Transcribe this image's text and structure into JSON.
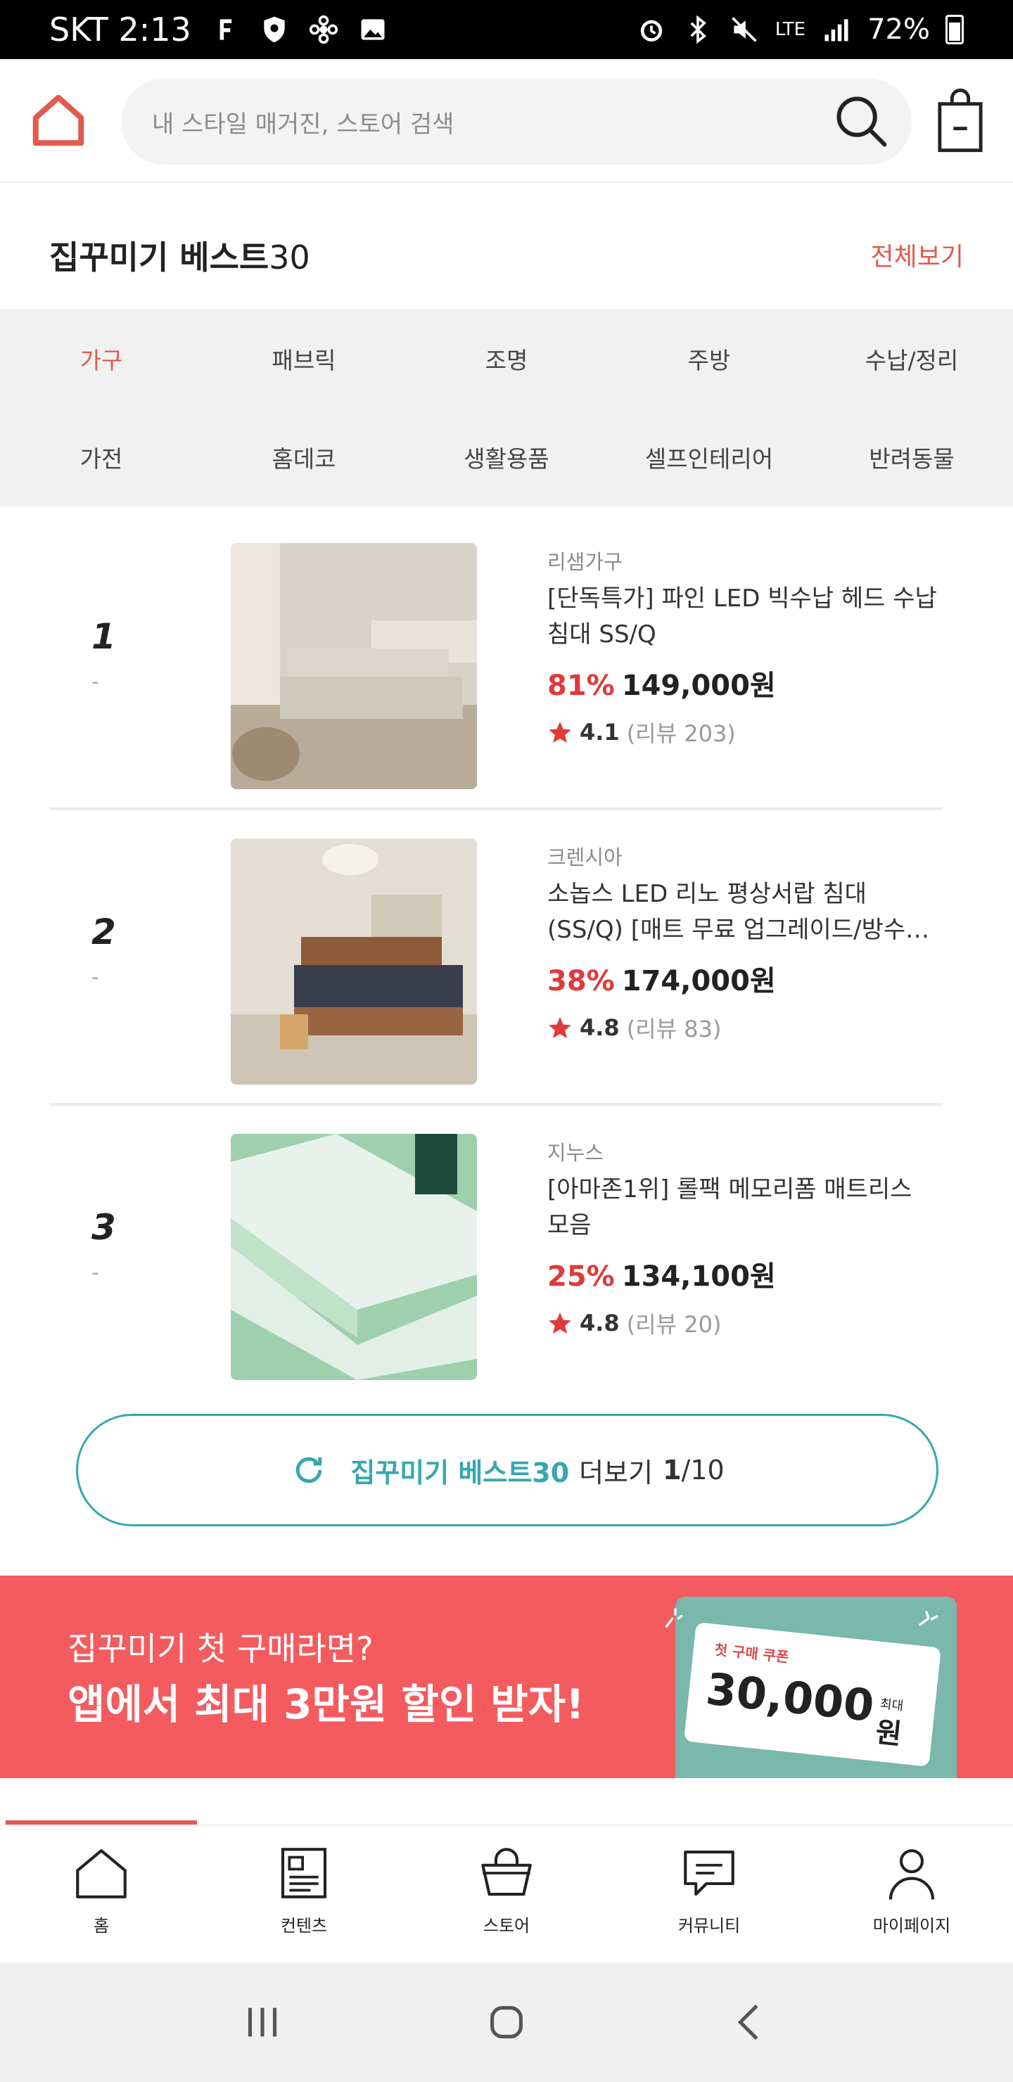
{
  "status_bar": {
    "carrier_time": "SKT 2:13",
    "network": "LTE",
    "battery": "72%",
    "icons": [
      "f-icon",
      "shield-icon",
      "pinwheel-icon",
      "image-icon",
      "alarm-icon",
      "bluetooth-icon",
      "mute-icon",
      "signal-icon",
      "battery-icon"
    ]
  },
  "header": {
    "search_placeholder": "내 스타일 매거진, 스토어 검색",
    "accent": "#e05a4e"
  },
  "best": {
    "title_main": "집꾸미기 베스트",
    "title_num": "30",
    "see_all": "전체보기",
    "categories": [
      {
        "label": "가구",
        "active": true
      },
      {
        "label": "패브릭",
        "active": false
      },
      {
        "label": "조명",
        "active": false
      },
      {
        "label": "주방",
        "active": false
      },
      {
        "label": "수납/정리",
        "active": false
      },
      {
        "label": "가전",
        "active": false
      },
      {
        "label": "홈데코",
        "active": false
      },
      {
        "label": "생활용품",
        "active": false
      },
      {
        "label": "셀프인테리어",
        "active": false
      },
      {
        "label": "반려동물",
        "active": false
      }
    ],
    "products": [
      {
        "rank": "1",
        "change": "-",
        "brand": "리샘가구",
        "name": "[단독특가] 파인 LED 빅수납 헤드 수납 침대 SS/Q",
        "discount": "81%",
        "price": "149,000원",
        "rating": "4.1",
        "reviews": "(리뷰 203)"
      },
      {
        "rank": "2",
        "change": "-",
        "brand": "크렌시아",
        "name": "소놉스 LED 리노 평상서랍 침대 (SS/Q) [매트 무료 업그레이드/방수…",
        "discount": "38%",
        "price": "174,000원",
        "rating": "4.8",
        "reviews": "(리뷰 83)"
      },
      {
        "rank": "3",
        "change": "-",
        "brand": "지누스",
        "name": "[아마존1위] 롤팩 메모리폼 매트리스 모음",
        "discount": "25%",
        "price": "134,100원",
        "rating": "4.8",
        "reviews": "(리뷰 20)"
      }
    ],
    "more": {
      "label_teal": "집꾸미기 베스트30",
      "label_rest": "더보기",
      "page_current": "1",
      "page_total": "/10"
    }
  },
  "banner": {
    "line1": "집꾸미기 첫 구매라면?",
    "line2": "앱에서 최대 3만원 할인 받자!",
    "coupon_tag": "첫 구매 쿠폰",
    "coupon_amount": "30,000",
    "coupon_max": "최대",
    "coupon_won": "원"
  },
  "bottom_nav": [
    {
      "label": "홈",
      "icon": "home-icon"
    },
    {
      "label": "컨텐츠",
      "icon": "content-icon"
    },
    {
      "label": "스토어",
      "icon": "store-icon"
    },
    {
      "label": "커뮤니티",
      "icon": "community-icon"
    },
    {
      "label": "마이페이지",
      "icon": "mypage-icon"
    }
  ]
}
